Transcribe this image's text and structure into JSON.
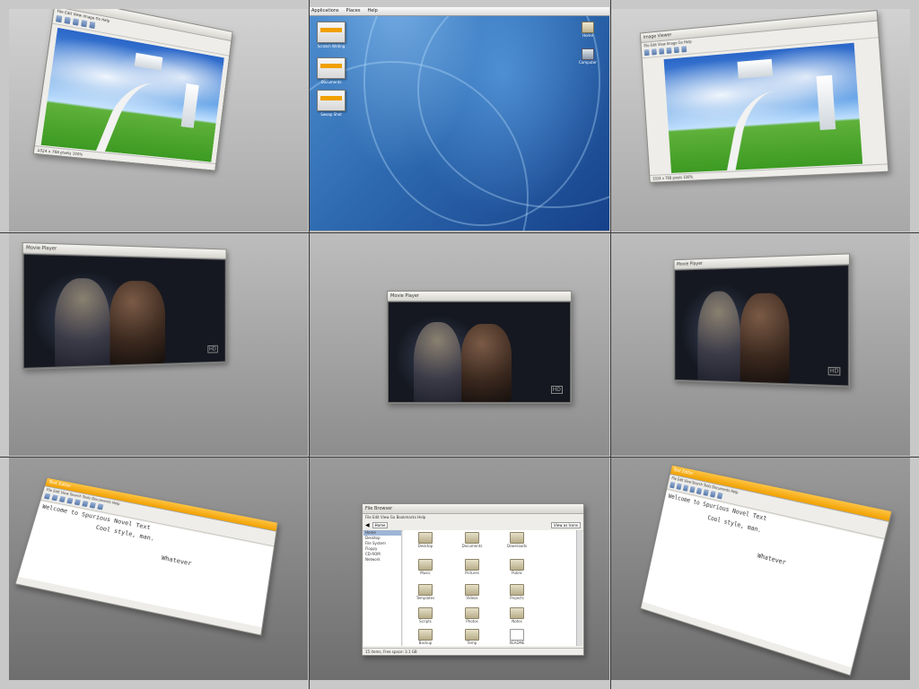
{
  "desktop": {
    "panel_items": [
      "Applications",
      "Places",
      "Help"
    ],
    "panel_clock": "",
    "launchers": [
      {
        "label": "Scratch Writing",
        "icon": "window-thumbnail-icon"
      },
      {
        "label": "Documents",
        "icon": "window-thumbnail-icon"
      },
      {
        "label": "Swoop Shot",
        "icon": "window-thumbnail-icon"
      }
    ],
    "system_icons": [
      {
        "label": "Home",
        "icon": "home-folder-icon"
      },
      {
        "label": "Computer",
        "icon": "computer-icon"
      }
    ]
  },
  "image_viewer": {
    "title": "Image Viewer",
    "menu": "File  Edit  View  Image  Go  Help",
    "status": "1024 x 768 pixels  100%"
  },
  "video_player": {
    "title": "Movie Player",
    "badge": "HD"
  },
  "text_editor": {
    "title": "Text Editor",
    "menu": "File  Edit  View  Search  Tools  Documents  Help",
    "lines": [
      "Welcome to Spurious Novel Text",
      "Cool style, man.",
      "Whatever"
    ]
  },
  "file_manager": {
    "title": "File Browser",
    "menu": "File  Edit  View  Go  Bookmarks  Help",
    "location": "Home",
    "view_mode": "View as Icons",
    "sidebar": [
      "Home",
      "Desktop",
      "File System",
      "Floppy",
      "CD-ROM",
      "Network"
    ],
    "items": [
      "Desktop",
      "Documents",
      "Downloads",
      "Music",
      "Pictures",
      "Public",
      "Templates",
      "Videos",
      "Projects",
      "Scripts",
      "Photos",
      "Notes",
      "Backup",
      "Temp",
      "README"
    ],
    "status": "15 items, Free space: 3.1 GB"
  },
  "colors": {
    "accent_orange": "#f0a000",
    "desktop_blue": "#2e6ab0"
  }
}
